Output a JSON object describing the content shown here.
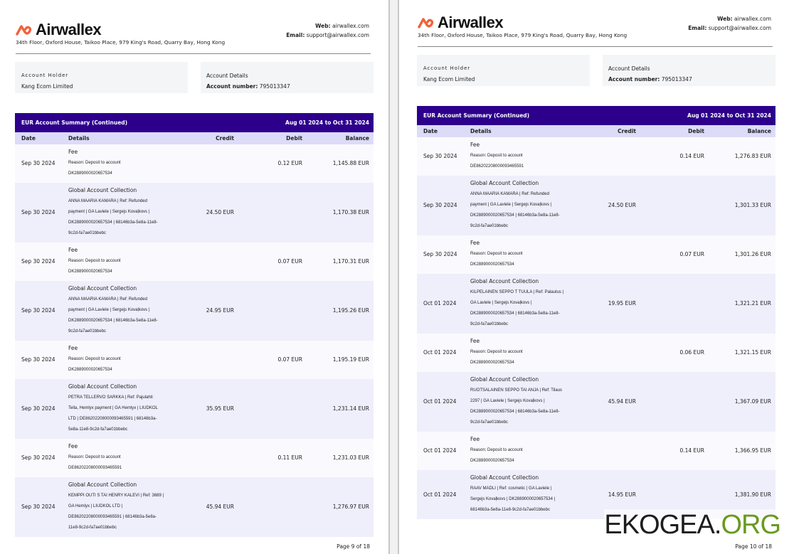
{
  "brand": {
    "name": "Airwallex",
    "address": "34th Floor, Oxford House, Taikoo Place, 979 King's Road, Quarry Bay, Hong Kong",
    "web_label": "Web:",
    "web": "airwallex.com",
    "email_label": "Email:",
    "email": "support@airwallex.com",
    "accent": "#2d008c"
  },
  "account": {
    "holder_label": "Account Holder",
    "holder": "Kang Ecom Limited",
    "details_label": "Account Details",
    "number_label": "Account number:",
    "number": "795013347"
  },
  "table": {
    "title": "EUR Account Summary (Continued)",
    "period": "Aug 01 2024 to Oct 31 2024",
    "columns": [
      "Date",
      "Details",
      "Credit",
      "Debit",
      "Balance"
    ]
  },
  "pages": [
    {
      "footer": "Page 9 of 18",
      "rows": [
        {
          "date": "Sep 30 2024",
          "title": "Fee",
          "lines": [
            "Reason: Deposit to account",
            "DK2889000020657534"
          ],
          "credit": "",
          "debit": "0.12 EUR",
          "balance": "1,145.88 EUR"
        },
        {
          "date": "Sep 30 2024",
          "title": "Global Account Collection",
          "lines": [
            "ANNA MAARIA KAMARA | Ref: Refunded",
            "payment | GA Laviele | Sergejs Kovaļkovs |",
            "DK2889000020657534 | 68146b3a-5e8a-11e8-",
            "9c2d-fa7ae01bbebc"
          ],
          "credit": "24.50 EUR",
          "debit": "",
          "balance": "1,170.38 EUR"
        },
        {
          "date": "Sep 30 2024",
          "title": "Fee",
          "lines": [
            "Reason: Deposit to account",
            "DK2889000020657534"
          ],
          "credit": "",
          "debit": "0.07 EUR",
          "balance": "1,170.31 EUR"
        },
        {
          "date": "Sep 30 2024",
          "title": "Global Account Collection",
          "lines": [
            "ANNA MAARIA KAMARA | Ref: Refunded",
            "payment | GA Laviele | Sergejs Kovaļkovs |",
            "DK2889000020657534 | 68146b3a-5e8a-11e8-",
            "9c2d-fa7ae01bbebc"
          ],
          "credit": "24.95 EUR",
          "debit": "",
          "balance": "1,195.26 EUR"
        },
        {
          "date": "Sep 30 2024",
          "title": "Fee",
          "lines": [
            "Reason: Deposit to account",
            "DK2889000020657534"
          ],
          "credit": "",
          "debit": "0.07 EUR",
          "balance": "1,195.19 EUR"
        },
        {
          "date": "Sep 30 2024",
          "title": "Global Account Collection",
          "lines": [
            "PETRA TELLERVO SARKKA | Ref: Pajulahti",
            "Tella, Hemlyx payment | GA Hemlyx | LIUDKOL",
            "LTD | DE86202208000093465591 | 68146b3a-",
            "5e8a-11e8-9c2d-fa7ae01bbebc"
          ],
          "credit": "35.95 EUR",
          "debit": "",
          "balance": "1,231.14 EUR"
        },
        {
          "date": "Sep 30 2024",
          "title": "Fee",
          "lines": [
            "Reason: Deposit to account",
            "DE86202208000093465591"
          ],
          "credit": "",
          "debit": "0.11 EUR",
          "balance": "1,231.03 EUR"
        },
        {
          "date": "Sep 30 2024",
          "title": "Global Account Collection",
          "lines": [
            "KEMPPI OUTI S TAI HENRY KALEVI | Ref: 3689 |",
            "GA Hemlyx | LIUDKOL LTD |",
            "DE86202208000093465591 | 68146b3a-5e8a-",
            "11e8-9c2d-fa7ae01bbebc"
          ],
          "credit": "45.94 EUR",
          "debit": "",
          "balance": "1,276.97 EUR"
        }
      ]
    },
    {
      "footer": "Page 10 of 18",
      "rows": [
        {
          "date": "Sep 30 2024",
          "title": "Fee",
          "lines": [
            "Reason: Deposit to account",
            "DE86202208000093465591"
          ],
          "credit": "",
          "debit": "0.14 EUR",
          "balance": "1,276.83 EUR"
        },
        {
          "date": "Sep 30 2024",
          "title": "Global Account Collection",
          "lines": [
            "ANNA MAARIA KAMARA | Ref: Refunded",
            "payment | GA Laviele | Sergejs Kovaļkovs |",
            "DK2889000020657534 | 68146b3a-5e8a-11e8-",
            "9c2d-fa7ae01bbebc"
          ],
          "credit": "24.50 EUR",
          "debit": "",
          "balance": "1,301.33 EUR"
        },
        {
          "date": "Sep 30 2024",
          "title": "Fee",
          "lines": [
            "Reason: Deposit to account",
            "DK2889000020657534"
          ],
          "credit": "",
          "debit": "0.07 EUR",
          "balance": "1,301.26 EUR"
        },
        {
          "date": "Oct 01 2024",
          "title": "Global Account Collection",
          "lines": [
            "KILPELAINEN SEPPO T TUULA | Ref: Palautus |",
            "GA Laviele | Sergejs Kovaļkovs |",
            "DK2889000020657534 | 68146b3a-5e8a-11e8-",
            "9c2d-fa7ae01bbebc"
          ],
          "credit": "19.95 EUR",
          "debit": "",
          "balance": "1,321.21 EUR"
        },
        {
          "date": "Oct 01 2024",
          "title": "Fee",
          "lines": [
            "Reason: Deposit to account",
            "DK2889000020657534"
          ],
          "credit": "",
          "debit": "0.06 EUR",
          "balance": "1,321.15 EUR"
        },
        {
          "date": "Oct 01 2024",
          "title": "Global Account Collection",
          "lines": [
            "RUOTSALAINEN SEPPO TAI ANJA | Ref: Tilaus",
            "2297 | GA Laviele | Sergejs Kovaļkovs |",
            "DK2889000020657534 | 68146b3a-5e8a-11e8-",
            "9c2d-fa7ae01bbebc"
          ],
          "credit": "45.94 EUR",
          "debit": "",
          "balance": "1,367.09 EUR"
        },
        {
          "date": "Oct 01 2024",
          "title": "Fee",
          "lines": [
            "Reason: Deposit to account",
            "DK2889000020657534"
          ],
          "credit": "",
          "debit": "0.14 EUR",
          "balance": "1,366.95 EUR"
        },
        {
          "date": "Oct 01 2024",
          "title": "Global Account Collection",
          "lines": [
            "RAAV MADLI | Ref: cosmetic | GA Laviele |",
            "Sergejs Kovaļkovs | DK2889000020657534 |",
            "68146b3a-5e8a-11e8-9c2d-fa7ae01bbebc"
          ],
          "credit": "14.95 EUR",
          "debit": "",
          "balance": "1,381.90 EUR"
        }
      ]
    }
  ],
  "watermark": {
    "main": "EKOGEA.",
    "tld": "ORG"
  }
}
